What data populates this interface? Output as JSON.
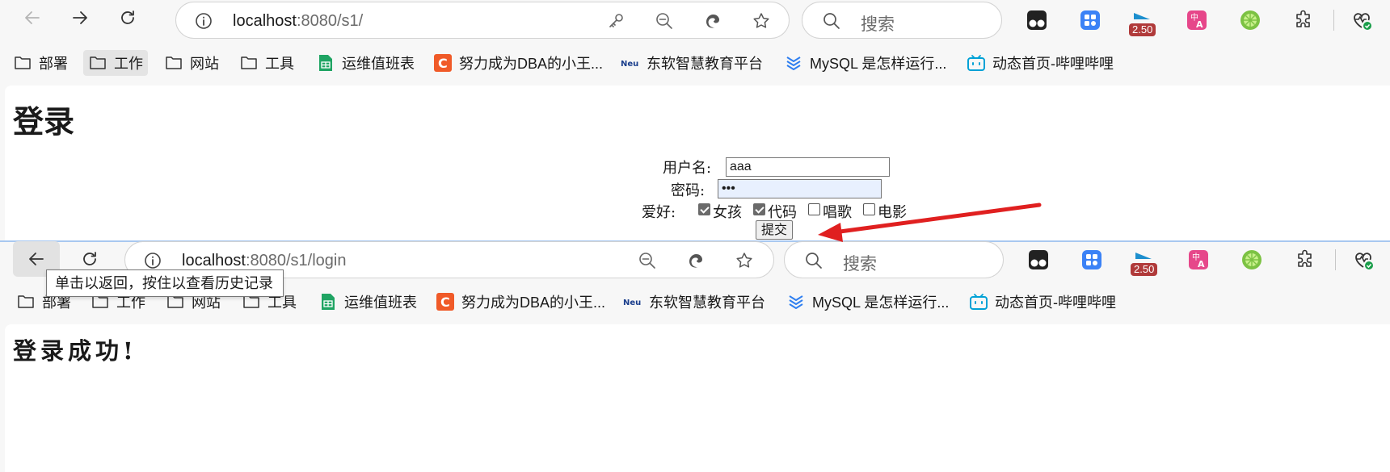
{
  "browser_top": {
    "url_host": "localhost",
    "url_rest": ":8080/s1/",
    "search_placeholder": "搜索",
    "ext_badge": "2.50"
  },
  "browser_bottom": {
    "url_host": "localhost",
    "url_rest": ":8080/s1/login",
    "search_placeholder": "搜索",
    "ext_badge": "2.50",
    "back_tooltip": "单击以返回，按住以查看历史记录"
  },
  "bookmarks": [
    {
      "label": "部署",
      "icon": "folder-icon"
    },
    {
      "label": "工作",
      "icon": "folder-icon"
    },
    {
      "label": "网站",
      "icon": "folder-icon"
    },
    {
      "label": "工具",
      "icon": "folder-icon"
    },
    {
      "label": "运维值班表",
      "icon": "sheets-icon"
    },
    {
      "label": "努力成为DBA的小王...",
      "icon": "c-logo-icon"
    },
    {
      "label": "东软智慧教育平台",
      "icon": "neu-logo-icon"
    },
    {
      "label": "MySQL 是怎样运行...",
      "icon": "chevron-stack-icon"
    },
    {
      "label": "动态首页-哔哩哔哩",
      "icon": "bilibili-icon"
    }
  ],
  "login_page": {
    "title": "登录",
    "username_label": "用户名:",
    "username_value": "aaa",
    "password_label": "密码:",
    "password_value": "•••",
    "hobby_label": "爱好:",
    "hobbies": [
      {
        "label": "女孩",
        "checked": true
      },
      {
        "label": "代码",
        "checked": true
      },
      {
        "label": "唱歌",
        "checked": false
      },
      {
        "label": "电影",
        "checked": false
      }
    ],
    "submit_label": "提交"
  },
  "success_page": {
    "title": "登录成功!"
  },
  "colors": {
    "arrow": "#e02020",
    "sheets_green": "#1fa463",
    "csdn_orange": "#f05a28",
    "neu_blue": "#1a3e8c",
    "bilibili_blue": "#00a1d6",
    "badge_red": "#b03a3a"
  }
}
